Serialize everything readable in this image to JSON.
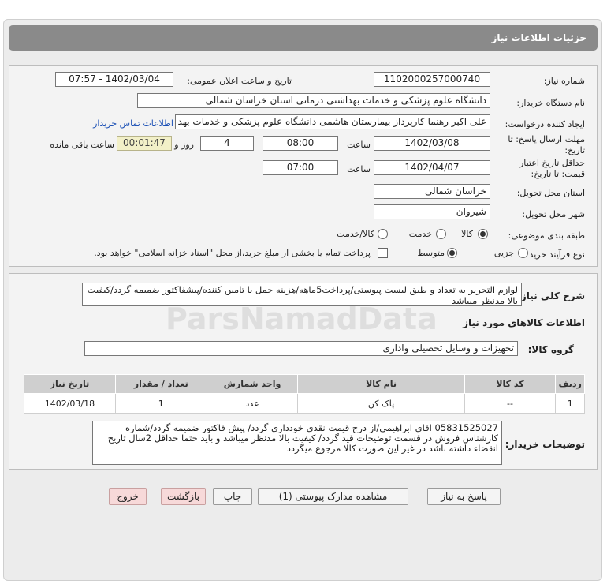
{
  "header": {
    "title": "جزئیات اطلاعات نیاز"
  },
  "form": {
    "need_number": {
      "label": "شماره نیاز:",
      "value": "1102000257000740"
    },
    "announce_datetime": {
      "label": "تاریخ و ساعت اعلان عمومی:",
      "value": "1402/03/04 - 07:57"
    },
    "buyer_org": {
      "label": "نام دستگاه خریدار:",
      "value": "دانشگاه علوم پزشکی و خدمات بهداشتی درمانی استان خراسان شمالی"
    },
    "requester": {
      "label": "ایجاد کننده درخواست:",
      "value": "علی اکبر رهنما کارپرداز بیمارستان هاشمی دانشگاه علوم پزشکی و خدمات بهد",
      "contact_link": "اطلاعات تماس خریدار"
    },
    "reply_deadline": {
      "label_line1": "مهلت ارسال پاسخ: تا",
      "label_line2": "تاریخ:",
      "date": "1402/03/08",
      "time_label": "ساعت",
      "time": "08:00",
      "days": "4",
      "days_label": "روز و",
      "remaining": "00:01:47",
      "remaining_label": "ساعت باقی مانده"
    },
    "price_validity": {
      "label_line1": "حداقل تاریخ اعتبار",
      "label_line2": "قیمت: تا تاریخ:",
      "date": "1402/04/07",
      "time_label": "ساعت",
      "time": "07:00"
    },
    "delivery_province": {
      "label": "استان محل تحویل:",
      "value": "خراسان شمالی"
    },
    "delivery_city": {
      "label": "شهر محل تحویل:",
      "value": "شیروان"
    },
    "category": {
      "label": "طبقه بندی موضوعی:",
      "options": [
        "کالا",
        "خدمت",
        "کالا/خدمت"
      ],
      "selected": "کالا"
    },
    "process_type": {
      "label": "نوع فرآیند خرید :",
      "options": [
        "جزیی",
        "متوسط"
      ],
      "selected": "متوسط",
      "payment_note": "پرداخت تمام یا بخشی از مبلغ خرید،از محل \"اسناد خزانه اسلامی\" خواهد بود."
    }
  },
  "summary": {
    "label": "شرح کلی نیاز:",
    "text": "لوازم التحریر به تعداد و طبق لیست پیوستی/پرداخت5ماهه/هزینه حمل با تامین کننده/پیشفاکتور ضمیمه گردد/کیفیت بالا مدنظر میباشد"
  },
  "goods": {
    "section_title": "اطلاعات کالاهای مورد نیاز",
    "group_label": "گروه کالا:",
    "group_value": "تجهیزات و وسایل تحصیلی واداری",
    "columns": [
      "ردیف",
      "کد کالا",
      "نام کالا",
      "واحد شمارش",
      "تعداد / مقدار",
      "تاریخ نیاز"
    ],
    "rows": [
      {
        "row": "1",
        "code": "--",
        "name": "پاک کن",
        "unit": "عدد",
        "qty": "1",
        "date": "1402/03/18"
      }
    ]
  },
  "buyer_notes": {
    "label": "توضیحات خریدار:",
    "text": "05831525027 اقای ابراهیمی/از درج قیمت نقدی خودداری گردد/ پیش فاکتور ضمیمه گردد/شماره کارشناس فروش در قسمت توضیحات قید گردد/ کیفیت بالا مدنظر میباشد و باید حتما حداقل 2سال تاریخ انقضاء داشته باشد  در غیر این صورت کالا مرجوع میگردد"
  },
  "buttons": {
    "reply": "پاسخ به نیاز",
    "attachments": "مشاهده مدارک پیوستی (1)",
    "print": "چاپ",
    "back": "بازگشت",
    "exit": "خروج"
  }
}
